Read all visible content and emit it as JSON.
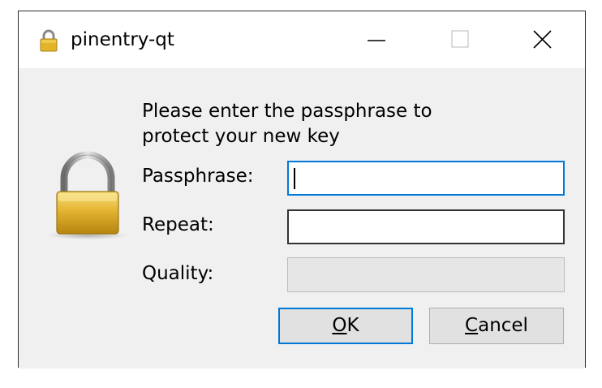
{
  "window": {
    "title": "pinentry-qt",
    "controls": {
      "minimize_icon": "minimize-icon",
      "maximize_icon": "maximize-icon",
      "close_icon": "close-icon"
    }
  },
  "dialog": {
    "prompt_line1": "Please enter the passphrase to",
    "prompt_line2": "protect your new key",
    "passphrase_label": "Passphrase:",
    "passphrase_value": "",
    "repeat_label": "Repeat:",
    "repeat_value": "",
    "quality_label": "Quality:",
    "quality_level": 0,
    "ok_mnemonic": "O",
    "ok_rest": "K",
    "cancel_mnemonic": "C",
    "cancel_rest": "ancel"
  },
  "icons": {
    "title_icon": "lock-icon",
    "dialog_icon": "padlock-icon"
  },
  "colors": {
    "focus_accent": "#0078d7",
    "window_background": "#f0f0f0",
    "lock_gold": "#e0b52c"
  }
}
